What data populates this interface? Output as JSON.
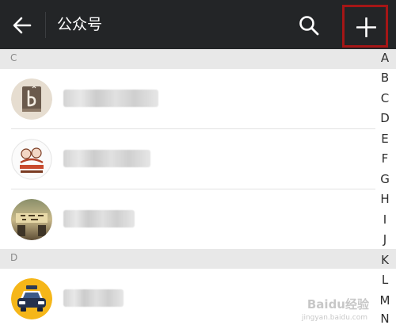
{
  "header": {
    "title": "公众号",
    "back_icon": "arrow-left-icon",
    "search_icon": "search-icon",
    "add_icon": "plus-icon"
  },
  "sections": [
    {
      "letter": "C",
      "accounts": [
        {
          "avatar": "cafe-logo-avatar",
          "name": ""
        },
        {
          "avatar": "cartoon-logo-avatar",
          "name": ""
        },
        {
          "avatar": "storefront-photo-avatar",
          "name": ""
        }
      ]
    },
    {
      "letter": "D",
      "accounts": [
        {
          "avatar": "taxi-icon-avatar",
          "name": ""
        }
      ]
    }
  ],
  "alphabet_index": [
    "A",
    "B",
    "C",
    "D",
    "E",
    "F",
    "G",
    "H",
    "I",
    "J",
    "K",
    "L",
    "M",
    "N"
  ],
  "watermark": {
    "text": "Baidu经验",
    "sub": "jingyan.baidu.com"
  },
  "colors": {
    "topbar": "#232527",
    "highlight_border": "#a51616",
    "section_header": "#e8e8e8"
  }
}
